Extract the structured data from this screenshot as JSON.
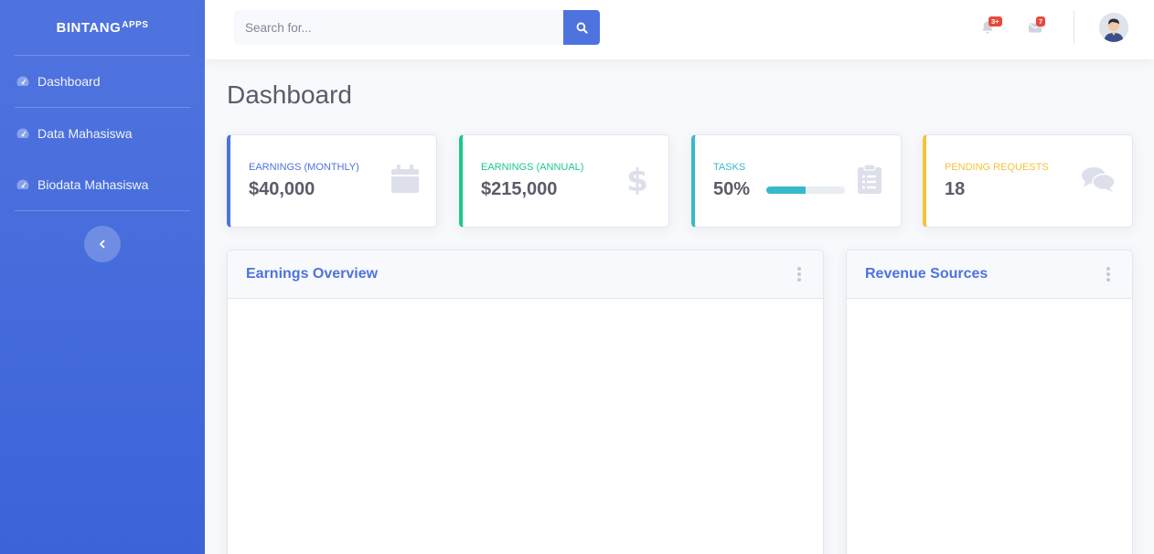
{
  "brand": {
    "name": "BINTANG",
    "sup": "APPS"
  },
  "sidebar": {
    "items": [
      {
        "label": "Dashboard",
        "icon": "tachometer-icon"
      },
      {
        "label": "Data Mahasiswa",
        "icon": "tachometer-icon"
      },
      {
        "label": "Biodata Mahasiswa",
        "icon": "tachometer-icon"
      }
    ],
    "toggle_icon": "chevron-left-icon"
  },
  "topbar": {
    "search": {
      "placeholder": "Search for...",
      "value": ""
    },
    "alerts_badge": "3+",
    "messages_badge": "7"
  },
  "page": {
    "title": "Dashboard"
  },
  "stats": [
    {
      "label": "Earnings (Monthly)",
      "value": "$40,000",
      "color": "#4e73df",
      "icon": "calendar-icon"
    },
    {
      "label": "Earnings (Annual)",
      "value": "$215,000",
      "color": "#1cc88a",
      "icon": "dollar-icon"
    },
    {
      "label": "Tasks",
      "value": "50%",
      "progress": 0.5,
      "color": "#36b9cc",
      "icon": "clipboard-list-icon"
    },
    {
      "label": "Pending Requests",
      "value": "18",
      "color": "#f6c23e",
      "icon": "comments-icon"
    }
  ],
  "panels": {
    "earnings": {
      "title": "Earnings Overview"
    },
    "revenue": {
      "title": "Revenue Sources"
    }
  },
  "colors": {
    "primary": "#4e73df",
    "success": "#1cc88a",
    "info": "#36b9cc",
    "warning": "#f6c23e",
    "danger": "#e74a3b"
  }
}
